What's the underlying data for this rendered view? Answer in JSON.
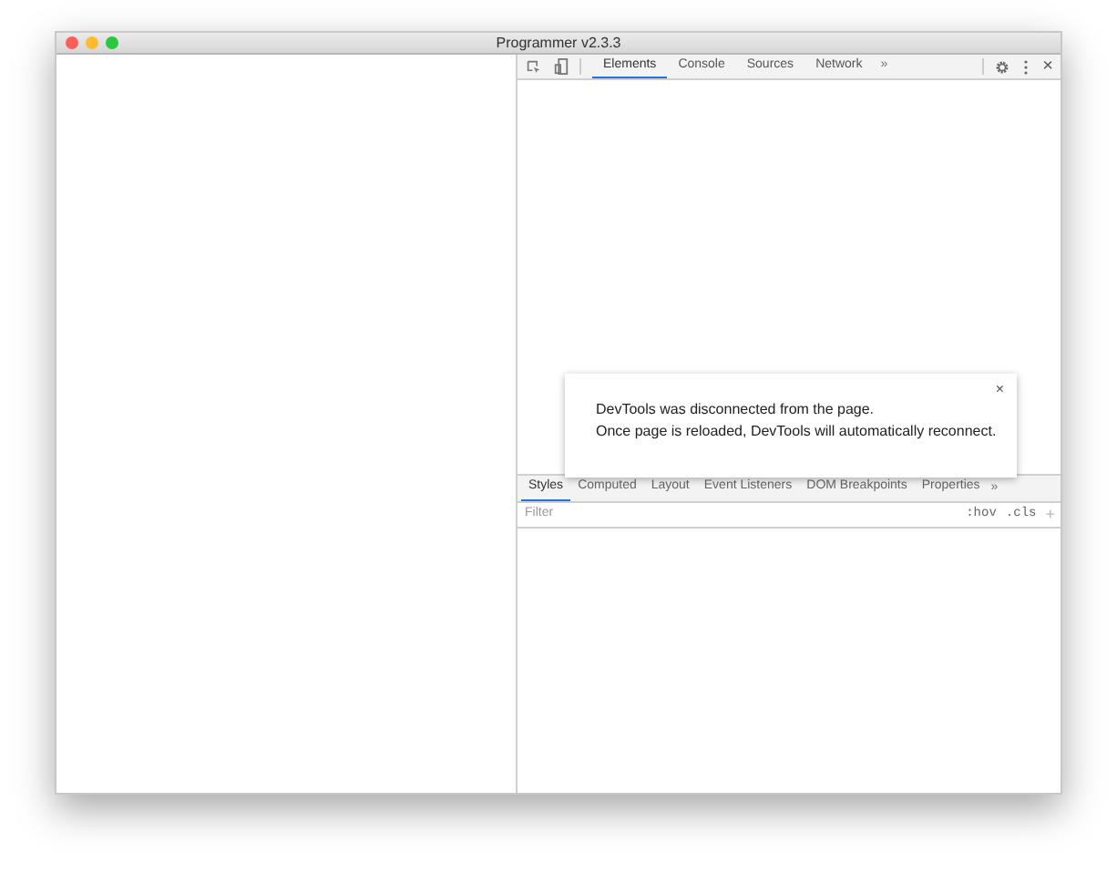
{
  "window": {
    "title": "Programmer v2.3.3"
  },
  "devtools": {
    "tabs": [
      {
        "label": "Elements",
        "selected": true
      },
      {
        "label": "Console",
        "selected": false
      },
      {
        "label": "Sources",
        "selected": false
      },
      {
        "label": "Network",
        "selected": false
      }
    ],
    "more": "»",
    "close": "×",
    "styles_tabs": [
      {
        "label": "Styles",
        "selected": true
      },
      {
        "label": "Computed",
        "selected": false
      },
      {
        "label": "Layout",
        "selected": false
      },
      {
        "label": "Event Listeners",
        "selected": false
      },
      {
        "label": "DOM Breakpoints",
        "selected": false
      },
      {
        "label": "Properties",
        "selected": false
      }
    ],
    "styles_more": "»",
    "filter": {
      "placeholder": "Filter"
    },
    "hov": ":hov",
    "cls": ".cls",
    "add": "+"
  },
  "toast": {
    "close": "×",
    "lines": [
      "DevTools was disconnected from the page.",
      "Once page is reloaded, DevTools will automatically reconnect."
    ]
  }
}
